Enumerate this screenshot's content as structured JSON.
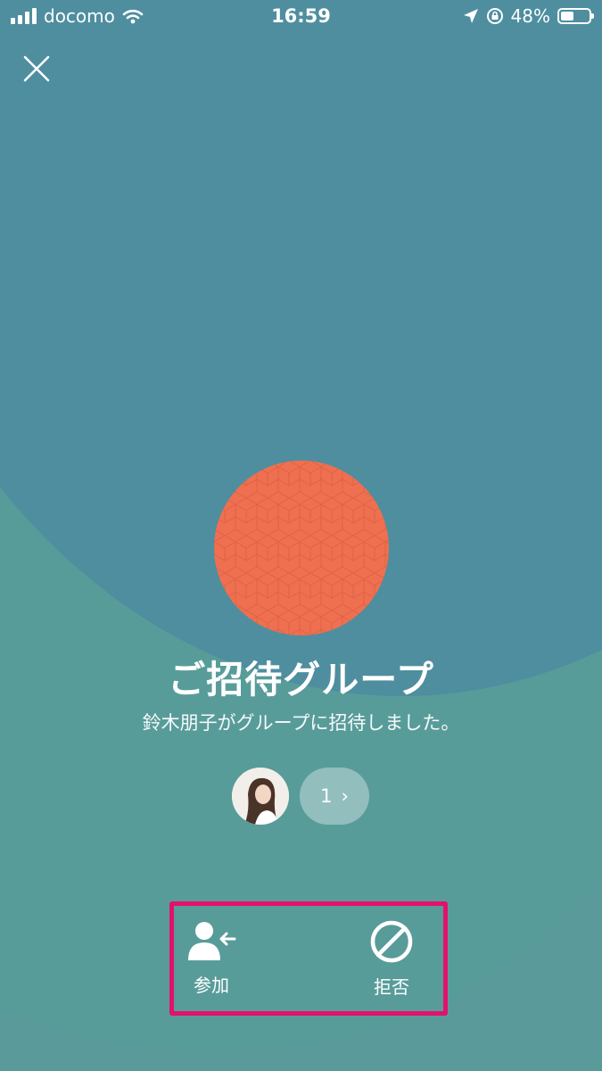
{
  "status_bar": {
    "carrier": "docomo",
    "time": "16:59",
    "battery": "48%",
    "battery_level": 0.48
  },
  "header": {
    "close_icon": "close-icon"
  },
  "group": {
    "title": "ご招待グループ",
    "subtitle": "鈴木朋子がグループに招待しました。",
    "avatar_color": "#ee7050"
  },
  "members": {
    "count": "1",
    "chevron": "›"
  },
  "actions": {
    "join_label": "参加",
    "decline_label": "拒否",
    "highlight_color": "#e3116b"
  }
}
